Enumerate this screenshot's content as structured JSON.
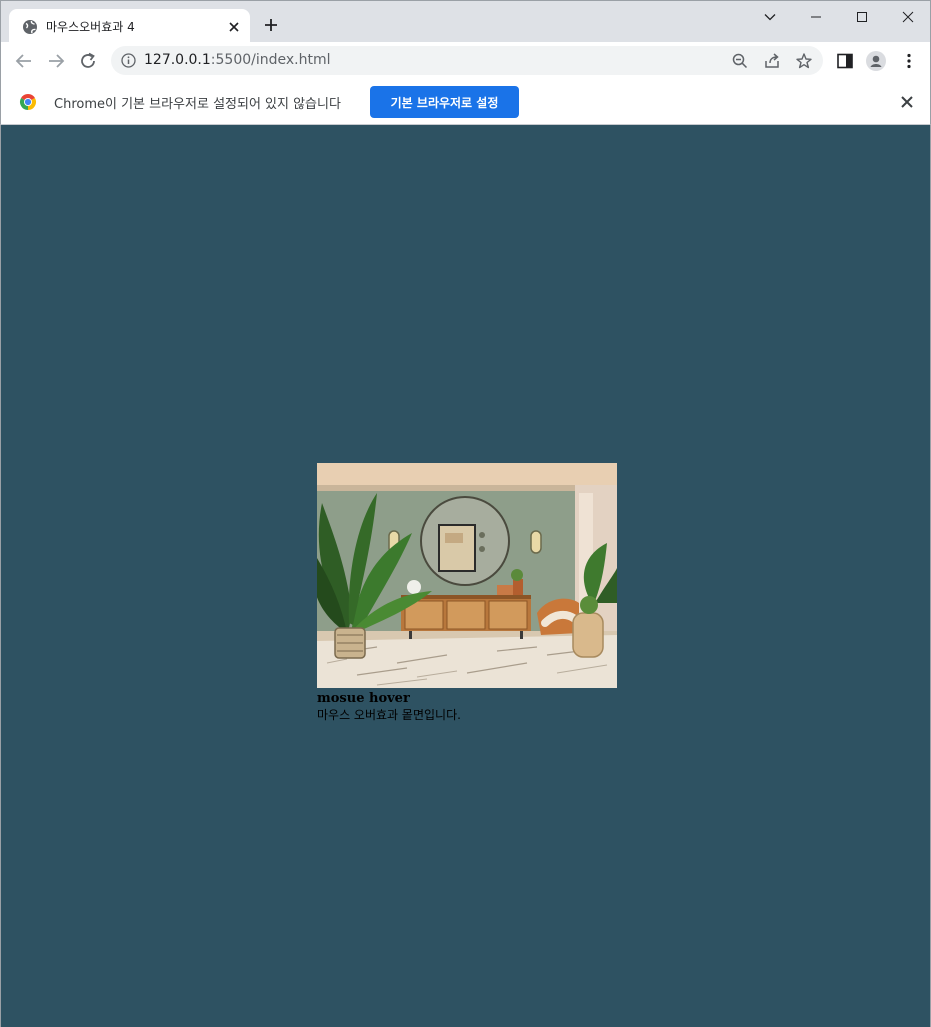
{
  "browser": {
    "tab": {
      "title": "마우스오버효과 4",
      "favicon": "globe-icon",
      "close_icon": "close-icon"
    },
    "new_tab_icon": "plus-icon",
    "window_controls": [
      "chevron-down-icon",
      "minimize-icon",
      "maximize-icon",
      "close-icon"
    ],
    "address": {
      "host": "127.0.0.1",
      "port": ":5500",
      "path": "/index.html"
    },
    "infobar": {
      "message": "Chrome이 기본 브라우저로 설정되어 있지 않습니다",
      "button_label": "기본 브라우저로 설정"
    }
  },
  "page": {
    "card": {
      "title": "mosue hover",
      "text": "마우스 오버효과 뫁면입니다."
    }
  },
  "colors": {
    "page_background": "#2e5262",
    "tabstrip": "#dee1e6",
    "primary_button": "#1a73e8"
  }
}
